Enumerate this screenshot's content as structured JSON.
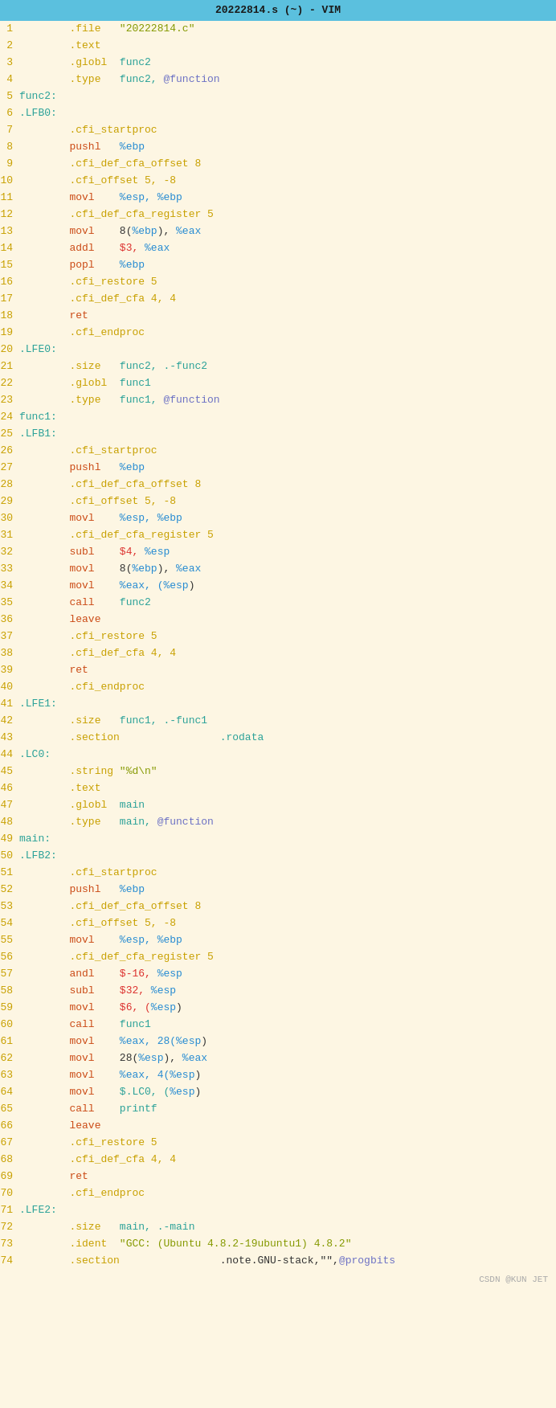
{
  "title": "20222814.s (~) - VIM",
  "lines": [
    {
      "num": 1,
      "tokens": [
        {
          "t": "\t",
          "c": ""
        },
        {
          "t": ".file",
          "c": "c-directive"
        },
        {
          "t": "\t\"20222814.c\"",
          "c": "c-string"
        }
      ]
    },
    {
      "num": 2,
      "tokens": [
        {
          "t": "\t",
          "c": ""
        },
        {
          "t": ".text",
          "c": "c-directive"
        }
      ]
    },
    {
      "num": 3,
      "tokens": [
        {
          "t": "\t",
          "c": ""
        },
        {
          "t": ".globl",
          "c": "c-directive"
        },
        {
          "t": "\tfunc2",
          "c": "c-func"
        }
      ]
    },
    {
      "num": 4,
      "tokens": [
        {
          "t": "\t",
          "c": ""
        },
        {
          "t": ".type",
          "c": "c-directive"
        },
        {
          "t": "\tfunc2, ",
          "c": "c-func"
        },
        {
          "t": "@function",
          "c": "c-at"
        }
      ]
    },
    {
      "num": 5,
      "tokens": [
        {
          "t": "func2:",
          "c": "c-label"
        }
      ]
    },
    {
      "num": 6,
      "tokens": [
        {
          "t": ".LFB0:",
          "c": "c-label"
        }
      ]
    },
    {
      "num": 7,
      "tokens": [
        {
          "t": "\t",
          "c": ""
        },
        {
          "t": ".cfi_startproc",
          "c": "c-directive"
        }
      ]
    },
    {
      "num": 8,
      "tokens": [
        {
          "t": "\t",
          "c": ""
        },
        {
          "t": "pushl",
          "c": "c-keyword"
        },
        {
          "t": "\t",
          "c": ""
        },
        {
          "t": "%ebp",
          "c": "c-reg"
        }
      ]
    },
    {
      "num": 9,
      "tokens": [
        {
          "t": "\t",
          "c": ""
        },
        {
          "t": ".cfi_def_cfa_offset 8",
          "c": "c-directive"
        }
      ]
    },
    {
      "num": 10,
      "tokens": [
        {
          "t": "\t",
          "c": ""
        },
        {
          "t": ".cfi_offset 5, -8",
          "c": "c-directive"
        }
      ]
    },
    {
      "num": 11,
      "tokens": [
        {
          "t": "\t",
          "c": ""
        },
        {
          "t": "movl",
          "c": "c-keyword"
        },
        {
          "t": "\t",
          "c": ""
        },
        {
          "t": "%esp, %ebp",
          "c": "c-reg"
        }
      ]
    },
    {
      "num": 12,
      "tokens": [
        {
          "t": "\t",
          "c": ""
        },
        {
          "t": ".cfi_def_cfa_register 5",
          "c": "c-directive"
        }
      ]
    },
    {
      "num": 13,
      "tokens": [
        {
          "t": "\t",
          "c": ""
        },
        {
          "t": "movl",
          "c": "c-keyword"
        },
        {
          "t": "\t",
          "c": ""
        },
        {
          "t": "8(",
          "c": "c-plain"
        },
        {
          "t": "%ebp",
          "c": "c-reg"
        },
        {
          "t": "), ",
          "c": "c-plain"
        },
        {
          "t": "%eax",
          "c": "c-reg"
        }
      ]
    },
    {
      "num": 14,
      "tokens": [
        {
          "t": "\t",
          "c": ""
        },
        {
          "t": "addl",
          "c": "c-keyword"
        },
        {
          "t": "\t",
          "c": ""
        },
        {
          "t": "$3, ",
          "c": "c-number"
        },
        {
          "t": "%eax",
          "c": "c-reg"
        }
      ]
    },
    {
      "num": 15,
      "tokens": [
        {
          "t": "\t",
          "c": ""
        },
        {
          "t": "popl",
          "c": "c-keyword"
        },
        {
          "t": "\t",
          "c": ""
        },
        {
          "t": "%ebp",
          "c": "c-reg"
        }
      ]
    },
    {
      "num": 16,
      "tokens": [
        {
          "t": "\t",
          "c": ""
        },
        {
          "t": ".cfi_restore 5",
          "c": "c-directive"
        }
      ]
    },
    {
      "num": 17,
      "tokens": [
        {
          "t": "\t",
          "c": ""
        },
        {
          "t": ".cfi_def_cfa 4, 4",
          "c": "c-directive"
        }
      ]
    },
    {
      "num": 18,
      "tokens": [
        {
          "t": "\t",
          "c": ""
        },
        {
          "t": "ret",
          "c": "c-keyword"
        }
      ]
    },
    {
      "num": 19,
      "tokens": [
        {
          "t": "\t",
          "c": ""
        },
        {
          "t": ".cfi_endproc",
          "c": "c-directive"
        }
      ]
    },
    {
      "num": 20,
      "tokens": [
        {
          "t": ".LFE0:",
          "c": "c-label"
        }
      ]
    },
    {
      "num": 21,
      "tokens": [
        {
          "t": "\t",
          "c": ""
        },
        {
          "t": ".size",
          "c": "c-directive"
        },
        {
          "t": "\tfunc2, .-func2",
          "c": "c-func"
        }
      ]
    },
    {
      "num": 22,
      "tokens": [
        {
          "t": "\t",
          "c": ""
        },
        {
          "t": ".globl",
          "c": "c-directive"
        },
        {
          "t": "\tfunc1",
          "c": "c-func"
        }
      ]
    },
    {
      "num": 23,
      "tokens": [
        {
          "t": "\t",
          "c": ""
        },
        {
          "t": ".type",
          "c": "c-directive"
        },
        {
          "t": "\tfunc1, ",
          "c": "c-func"
        },
        {
          "t": "@function",
          "c": "c-at"
        }
      ]
    },
    {
      "num": 24,
      "tokens": [
        {
          "t": "func1:",
          "c": "c-label"
        }
      ]
    },
    {
      "num": 25,
      "tokens": [
        {
          "t": ".LFB1:",
          "c": "c-label"
        }
      ]
    },
    {
      "num": 26,
      "tokens": [
        {
          "t": "\t",
          "c": ""
        },
        {
          "t": ".cfi_startproc",
          "c": "c-directive"
        }
      ]
    },
    {
      "num": 27,
      "tokens": [
        {
          "t": "\t",
          "c": ""
        },
        {
          "t": "pushl",
          "c": "c-keyword"
        },
        {
          "t": "\t",
          "c": ""
        },
        {
          "t": "%ebp",
          "c": "c-reg"
        }
      ]
    },
    {
      "num": 28,
      "tokens": [
        {
          "t": "\t",
          "c": ""
        },
        {
          "t": ".cfi_def_cfa_offset 8",
          "c": "c-directive"
        }
      ]
    },
    {
      "num": 29,
      "tokens": [
        {
          "t": "\t",
          "c": ""
        },
        {
          "t": ".cfi_offset 5, -8",
          "c": "c-directive"
        }
      ]
    },
    {
      "num": 30,
      "tokens": [
        {
          "t": "\t",
          "c": ""
        },
        {
          "t": "movl",
          "c": "c-keyword"
        },
        {
          "t": "\t",
          "c": ""
        },
        {
          "t": "%esp, %ebp",
          "c": "c-reg"
        }
      ]
    },
    {
      "num": 31,
      "tokens": [
        {
          "t": "\t",
          "c": ""
        },
        {
          "t": ".cfi_def_cfa_register 5",
          "c": "c-directive"
        }
      ]
    },
    {
      "num": 32,
      "tokens": [
        {
          "t": "\t",
          "c": ""
        },
        {
          "t": "subl",
          "c": "c-keyword"
        },
        {
          "t": "\t",
          "c": ""
        },
        {
          "t": "$4, ",
          "c": "c-number"
        },
        {
          "t": "%esp",
          "c": "c-reg"
        }
      ]
    },
    {
      "num": 33,
      "tokens": [
        {
          "t": "\t",
          "c": ""
        },
        {
          "t": "movl",
          "c": "c-keyword"
        },
        {
          "t": "\t",
          "c": ""
        },
        {
          "t": "8(",
          "c": "c-plain"
        },
        {
          "t": "%ebp",
          "c": "c-reg"
        },
        {
          "t": "), ",
          "c": "c-plain"
        },
        {
          "t": "%eax",
          "c": "c-reg"
        }
      ]
    },
    {
      "num": 34,
      "tokens": [
        {
          "t": "\t",
          "c": ""
        },
        {
          "t": "movl",
          "c": "c-keyword"
        },
        {
          "t": "\t",
          "c": ""
        },
        {
          "t": "%eax, (",
          "c": "c-reg"
        },
        {
          "t": "%esp",
          "c": "c-reg"
        },
        {
          "t": ")",
          "c": "c-plain"
        }
      ]
    },
    {
      "num": 35,
      "tokens": [
        {
          "t": "\t",
          "c": ""
        },
        {
          "t": "call",
          "c": "c-keyword"
        },
        {
          "t": "\t",
          "c": ""
        },
        {
          "t": "func2",
          "c": "c-func"
        }
      ]
    },
    {
      "num": 36,
      "tokens": [
        {
          "t": "\t",
          "c": ""
        },
        {
          "t": "leave",
          "c": "c-keyword"
        }
      ]
    },
    {
      "num": 37,
      "tokens": [
        {
          "t": "\t",
          "c": ""
        },
        {
          "t": ".cfi_restore 5",
          "c": "c-directive"
        }
      ]
    },
    {
      "num": 38,
      "tokens": [
        {
          "t": "\t",
          "c": ""
        },
        {
          "t": ".cfi_def_cfa 4, 4",
          "c": "c-directive"
        }
      ]
    },
    {
      "num": 39,
      "tokens": [
        {
          "t": "\t",
          "c": ""
        },
        {
          "t": "ret",
          "c": "c-keyword"
        }
      ]
    },
    {
      "num": 40,
      "tokens": [
        {
          "t": "\t",
          "c": ""
        },
        {
          "t": ".cfi_endproc",
          "c": "c-directive"
        }
      ]
    },
    {
      "num": 41,
      "tokens": [
        {
          "t": ".LFE1:",
          "c": "c-label"
        }
      ]
    },
    {
      "num": 42,
      "tokens": [
        {
          "t": "\t",
          "c": ""
        },
        {
          "t": ".size",
          "c": "c-directive"
        },
        {
          "t": "\tfunc1, .-func1",
          "c": "c-func"
        }
      ]
    },
    {
      "num": 43,
      "tokens": [
        {
          "t": "\t",
          "c": ""
        },
        {
          "t": ".section",
          "c": "c-directive"
        },
        {
          "t": "\t\t.rodata",
          "c": "c-func"
        }
      ]
    },
    {
      "num": 44,
      "tokens": [
        {
          "t": ".LC0:",
          "c": "c-label"
        }
      ]
    },
    {
      "num": 45,
      "tokens": [
        {
          "t": "\t",
          "c": ""
        },
        {
          "t": ".string",
          "c": "c-directive"
        },
        {
          "t": " \"%d\\n\"",
          "c": "c-string"
        }
      ]
    },
    {
      "num": 46,
      "tokens": [
        {
          "t": "\t",
          "c": ""
        },
        {
          "t": ".text",
          "c": "c-directive"
        }
      ]
    },
    {
      "num": 47,
      "tokens": [
        {
          "t": "\t",
          "c": ""
        },
        {
          "t": ".globl",
          "c": "c-directive"
        },
        {
          "t": "\tmain",
          "c": "c-func"
        }
      ]
    },
    {
      "num": 48,
      "tokens": [
        {
          "t": "\t",
          "c": ""
        },
        {
          "t": ".type",
          "c": "c-directive"
        },
        {
          "t": "\tmain, ",
          "c": "c-func"
        },
        {
          "t": "@function",
          "c": "c-at"
        }
      ]
    },
    {
      "num": 49,
      "tokens": [
        {
          "t": "main:",
          "c": "c-label"
        }
      ]
    },
    {
      "num": 50,
      "tokens": [
        {
          "t": ".LFB2:",
          "c": "c-label"
        }
      ]
    },
    {
      "num": 51,
      "tokens": [
        {
          "t": "\t",
          "c": ""
        },
        {
          "t": ".cfi_startproc",
          "c": "c-directive"
        }
      ]
    },
    {
      "num": 52,
      "tokens": [
        {
          "t": "\t",
          "c": ""
        },
        {
          "t": "pushl",
          "c": "c-keyword"
        },
        {
          "t": "\t",
          "c": ""
        },
        {
          "t": "%ebp",
          "c": "c-reg"
        }
      ]
    },
    {
      "num": 53,
      "tokens": [
        {
          "t": "\t",
          "c": ""
        },
        {
          "t": ".cfi_def_cfa_offset 8",
          "c": "c-directive"
        }
      ]
    },
    {
      "num": 54,
      "tokens": [
        {
          "t": "\t",
          "c": ""
        },
        {
          "t": ".cfi_offset 5, -8",
          "c": "c-directive"
        }
      ]
    },
    {
      "num": 55,
      "tokens": [
        {
          "t": "\t",
          "c": ""
        },
        {
          "t": "movl",
          "c": "c-keyword"
        },
        {
          "t": "\t",
          "c": ""
        },
        {
          "t": "%esp, %ebp",
          "c": "c-reg"
        }
      ]
    },
    {
      "num": 56,
      "tokens": [
        {
          "t": "\t",
          "c": ""
        },
        {
          "t": ".cfi_def_cfa_register 5",
          "c": "c-directive"
        }
      ]
    },
    {
      "num": 57,
      "tokens": [
        {
          "t": "\t",
          "c": ""
        },
        {
          "t": "andl",
          "c": "c-keyword"
        },
        {
          "t": "\t",
          "c": ""
        },
        {
          "t": "$-16, ",
          "c": "c-number"
        },
        {
          "t": "%esp",
          "c": "c-reg"
        }
      ]
    },
    {
      "num": 58,
      "tokens": [
        {
          "t": "\t",
          "c": ""
        },
        {
          "t": "subl",
          "c": "c-keyword"
        },
        {
          "t": "\t",
          "c": ""
        },
        {
          "t": "$32, ",
          "c": "c-number"
        },
        {
          "t": "%esp",
          "c": "c-reg"
        }
      ]
    },
    {
      "num": 59,
      "tokens": [
        {
          "t": "\t",
          "c": ""
        },
        {
          "t": "movl",
          "c": "c-keyword"
        },
        {
          "t": "\t",
          "c": ""
        },
        {
          "t": "$6, (",
          "c": "c-number"
        },
        {
          "t": "%esp",
          "c": "c-reg"
        },
        {
          "t": ")",
          "c": "c-plain"
        }
      ]
    },
    {
      "num": 60,
      "tokens": [
        {
          "t": "\t",
          "c": ""
        },
        {
          "t": "call",
          "c": "c-keyword"
        },
        {
          "t": "\t",
          "c": ""
        },
        {
          "t": "func1",
          "c": "c-func"
        }
      ]
    },
    {
      "num": 61,
      "tokens": [
        {
          "t": "\t",
          "c": ""
        },
        {
          "t": "movl",
          "c": "c-keyword"
        },
        {
          "t": "\t",
          "c": ""
        },
        {
          "t": "%eax, 28(",
          "c": "c-reg"
        },
        {
          "t": "%esp",
          "c": "c-reg"
        },
        {
          "t": ")",
          "c": "c-plain"
        }
      ]
    },
    {
      "num": 62,
      "tokens": [
        {
          "t": "\t",
          "c": ""
        },
        {
          "t": "movl",
          "c": "c-keyword"
        },
        {
          "t": "\t",
          "c": ""
        },
        {
          "t": "28(",
          "c": "c-plain"
        },
        {
          "t": "%esp",
          "c": "c-reg"
        },
        {
          "t": "), ",
          "c": "c-plain"
        },
        {
          "t": "%eax",
          "c": "c-reg"
        }
      ]
    },
    {
      "num": 63,
      "tokens": [
        {
          "t": "\t",
          "c": ""
        },
        {
          "t": "movl",
          "c": "c-keyword"
        },
        {
          "t": "\t",
          "c": ""
        },
        {
          "t": "%eax, 4(",
          "c": "c-reg"
        },
        {
          "t": "%esp",
          "c": "c-reg"
        },
        {
          "t": ")",
          "c": "c-plain"
        }
      ]
    },
    {
      "num": 64,
      "tokens": [
        {
          "t": "\t",
          "c": ""
        },
        {
          "t": "movl",
          "c": "c-keyword"
        },
        {
          "t": "\t",
          "c": ""
        },
        {
          "t": "$.LC0, (",
          "c": "c-func"
        },
        {
          "t": "%esp",
          "c": "c-reg"
        },
        {
          "t": ")",
          "c": "c-plain"
        }
      ]
    },
    {
      "num": 65,
      "tokens": [
        {
          "t": "\t",
          "c": ""
        },
        {
          "t": "call",
          "c": "c-keyword"
        },
        {
          "t": "\t",
          "c": ""
        },
        {
          "t": "printf",
          "c": "c-func"
        }
      ]
    },
    {
      "num": 66,
      "tokens": [
        {
          "t": "\t",
          "c": ""
        },
        {
          "t": "leave",
          "c": "c-keyword"
        }
      ]
    },
    {
      "num": 67,
      "tokens": [
        {
          "t": "\t",
          "c": ""
        },
        {
          "t": ".cfi_restore 5",
          "c": "c-directive"
        }
      ]
    },
    {
      "num": 68,
      "tokens": [
        {
          "t": "\t",
          "c": ""
        },
        {
          "t": ".cfi_def_cfa 4, 4",
          "c": "c-directive"
        }
      ]
    },
    {
      "num": 69,
      "tokens": [
        {
          "t": "\t",
          "c": ""
        },
        {
          "t": "ret",
          "c": "c-keyword"
        }
      ]
    },
    {
      "num": 70,
      "tokens": [
        {
          "t": "\t",
          "c": ""
        },
        {
          "t": ".cfi_endproc",
          "c": "c-directive"
        }
      ]
    },
    {
      "num": 71,
      "tokens": [
        {
          "t": ".LFE2:",
          "c": "c-label"
        }
      ]
    },
    {
      "num": 72,
      "tokens": [
        {
          "t": "\t",
          "c": ""
        },
        {
          "t": ".size",
          "c": "c-directive"
        },
        {
          "t": "\tmain, .-main",
          "c": "c-func"
        }
      ]
    },
    {
      "num": 73,
      "tokens": [
        {
          "t": "\t",
          "c": ""
        },
        {
          "t": ".ident",
          "c": "c-directive"
        },
        {
          "t": "\t\"GCC: (Ubuntu 4.8.2-19ubuntu1) 4.8.2\"",
          "c": "c-string"
        }
      ]
    },
    {
      "num": 74,
      "tokens": [
        {
          "t": "\t",
          "c": ""
        },
        {
          "t": ".section",
          "c": "c-directive"
        },
        {
          "t": "\t\t.note.GNU-stack,\"\",",
          "c": "c-plain"
        },
        {
          "t": "@progbits",
          "c": "c-at"
        }
      ]
    }
  ],
  "watermark": "CSDN @KUN JET"
}
